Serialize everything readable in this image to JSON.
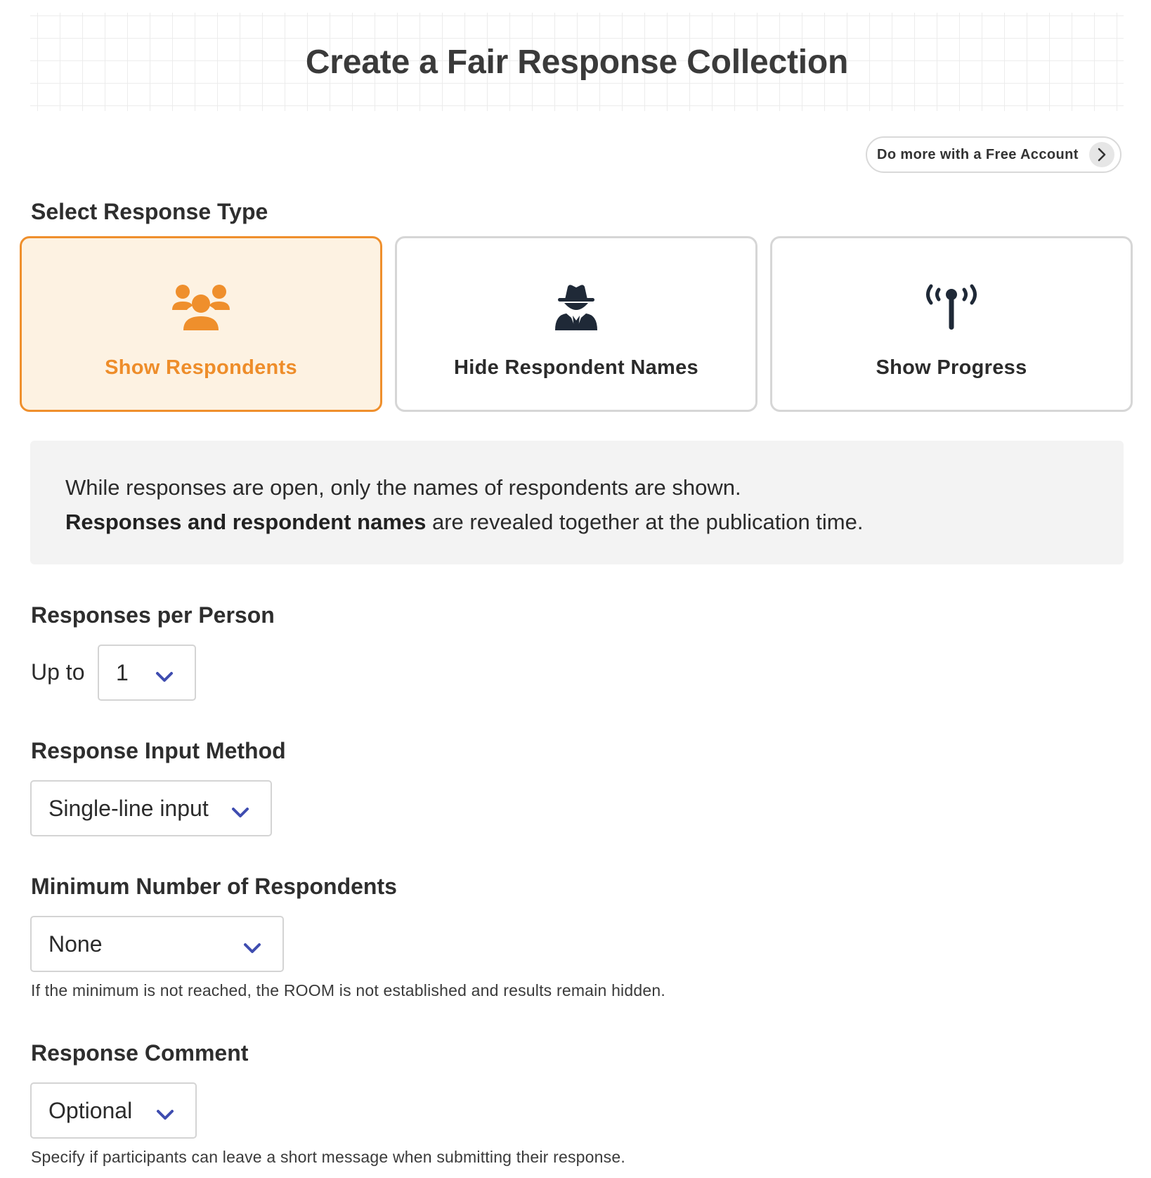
{
  "header": {
    "title": "Create a Fair Response Collection"
  },
  "account_button": {
    "label": "Do more with a Free Account",
    "icon": "chevron-right-icon"
  },
  "response_type": {
    "label": "Select Response Type",
    "options": [
      {
        "label": "Show Respondents",
        "icon": "users-icon",
        "selected": true
      },
      {
        "label": "Hide Respondent Names",
        "icon": "incognito-spy-icon",
        "selected": false
      },
      {
        "label": "Show Progress",
        "icon": "broadcast-tower-icon",
        "selected": false
      }
    ]
  },
  "info": {
    "line1": "While responses are open, only the names of respondents are shown.",
    "line2_bold": "Responses and respondent names",
    "line2_rest": " are revealed together at the publication time."
  },
  "responses_per_person": {
    "label": "Responses per Person",
    "prefix": "Up to",
    "value": "1"
  },
  "input_method": {
    "label": "Response Input Method",
    "value": "Single-line input"
  },
  "min_respondents": {
    "label": "Minimum Number of Respondents",
    "value": "None",
    "help": "If the minimum is not reached, the ROOM is not established and results remain hidden."
  },
  "response_comment": {
    "label": "Response Comment",
    "value": "Optional",
    "help": "Specify if participants can leave a short message when submitting their response."
  },
  "colors": {
    "accent": "#ef8f2c",
    "accent_bg": "#fdf2e2",
    "chevron": "#3f4db0",
    "info_bg": "#f3f3f3"
  }
}
